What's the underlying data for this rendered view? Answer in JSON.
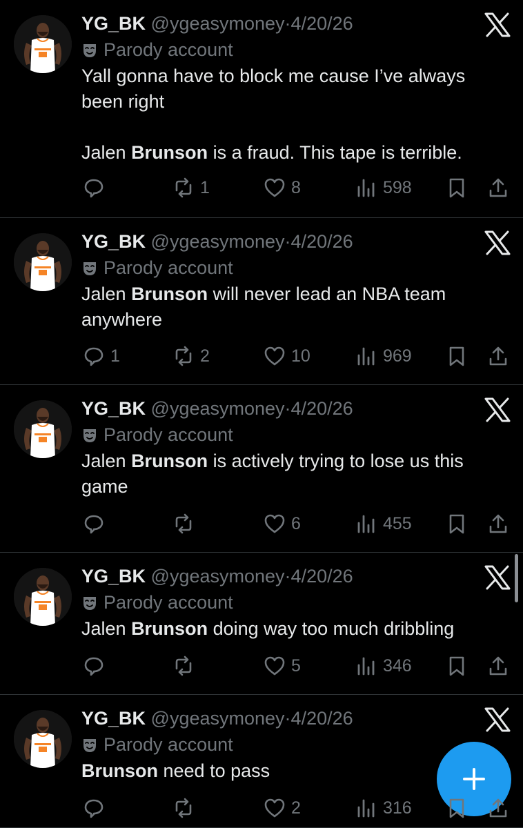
{
  "tweets": [
    {
      "name": "YG_BK",
      "handle": "@ygeasymoney",
      "dot": "·",
      "date": "4/20/26",
      "parody_label": "Parody account",
      "lines": [
        [
          {
            "t": "Yall gonna have to block me cause I’ve always"
          }
        ],
        [
          {
            "t": "been right"
          }
        ],
        [],
        [
          {
            "t": "Jalen "
          },
          {
            "t": "Brunson",
            "b": true
          },
          {
            "t": " is a fraud. This tape is terrible."
          }
        ]
      ],
      "replies": "",
      "reposts": "1",
      "likes": "8",
      "views": "598"
    },
    {
      "name": "YG_BK",
      "handle": "@ygeasymoney",
      "dot": "·",
      "date": "4/20/26",
      "parody_label": "Parody account",
      "lines": [
        [
          {
            "t": "Jalen "
          },
          {
            "t": "Brunson",
            "b": true
          },
          {
            "t": " will never lead an NBA team"
          }
        ],
        [
          {
            "t": "anywhere"
          }
        ]
      ],
      "replies": "1",
      "reposts": "2",
      "likes": "10",
      "views": "969"
    },
    {
      "name": "YG_BK",
      "handle": "@ygeasymoney",
      "dot": "·",
      "date": "4/20/26",
      "parody_label": "Parody account",
      "lines": [
        [
          {
            "t": "Jalen "
          },
          {
            "t": "Brunson",
            "b": true
          },
          {
            "t": " is actively trying to lose us this"
          }
        ],
        [
          {
            "t": "game"
          }
        ]
      ],
      "replies": "",
      "reposts": "",
      "likes": "6",
      "views": "455"
    },
    {
      "name": "YG_BK",
      "handle": "@ygeasymoney",
      "dot": "·",
      "date": "4/20/26",
      "parody_label": "Parody account",
      "lines": [
        [
          {
            "t": "Jalen "
          },
          {
            "t": "Brunson",
            "b": true
          },
          {
            "t": " doing way too much dribbling"
          }
        ]
      ],
      "replies": "",
      "reposts": "",
      "likes": "5",
      "views": "346"
    },
    {
      "name": "YG_BK",
      "handle": "@ygeasymoney",
      "dot": "·",
      "date": "4/20/26",
      "parody_label": "Parody account",
      "lines": [
        [
          {
            "t": "Brunson",
            "b": true
          },
          {
            "t": " need to pass"
          }
        ]
      ],
      "replies": "",
      "reposts": "",
      "likes": "2",
      "views": "316"
    }
  ],
  "icons": {
    "reply": "reply-icon",
    "repost": "repost-icon",
    "like": "heart-icon",
    "views": "views-icon",
    "bookmark": "bookmark-icon",
    "share": "share-icon",
    "platform": "x-logo-icon",
    "parody": "parody-mask-icon",
    "compose": "plus-icon"
  },
  "colors": {
    "background": "#000000",
    "text": "#e7e9ea",
    "muted": "#71767b",
    "accent": "#1d9bf0",
    "jersey": "#ffffff",
    "jersey_trim": "#f58426"
  }
}
